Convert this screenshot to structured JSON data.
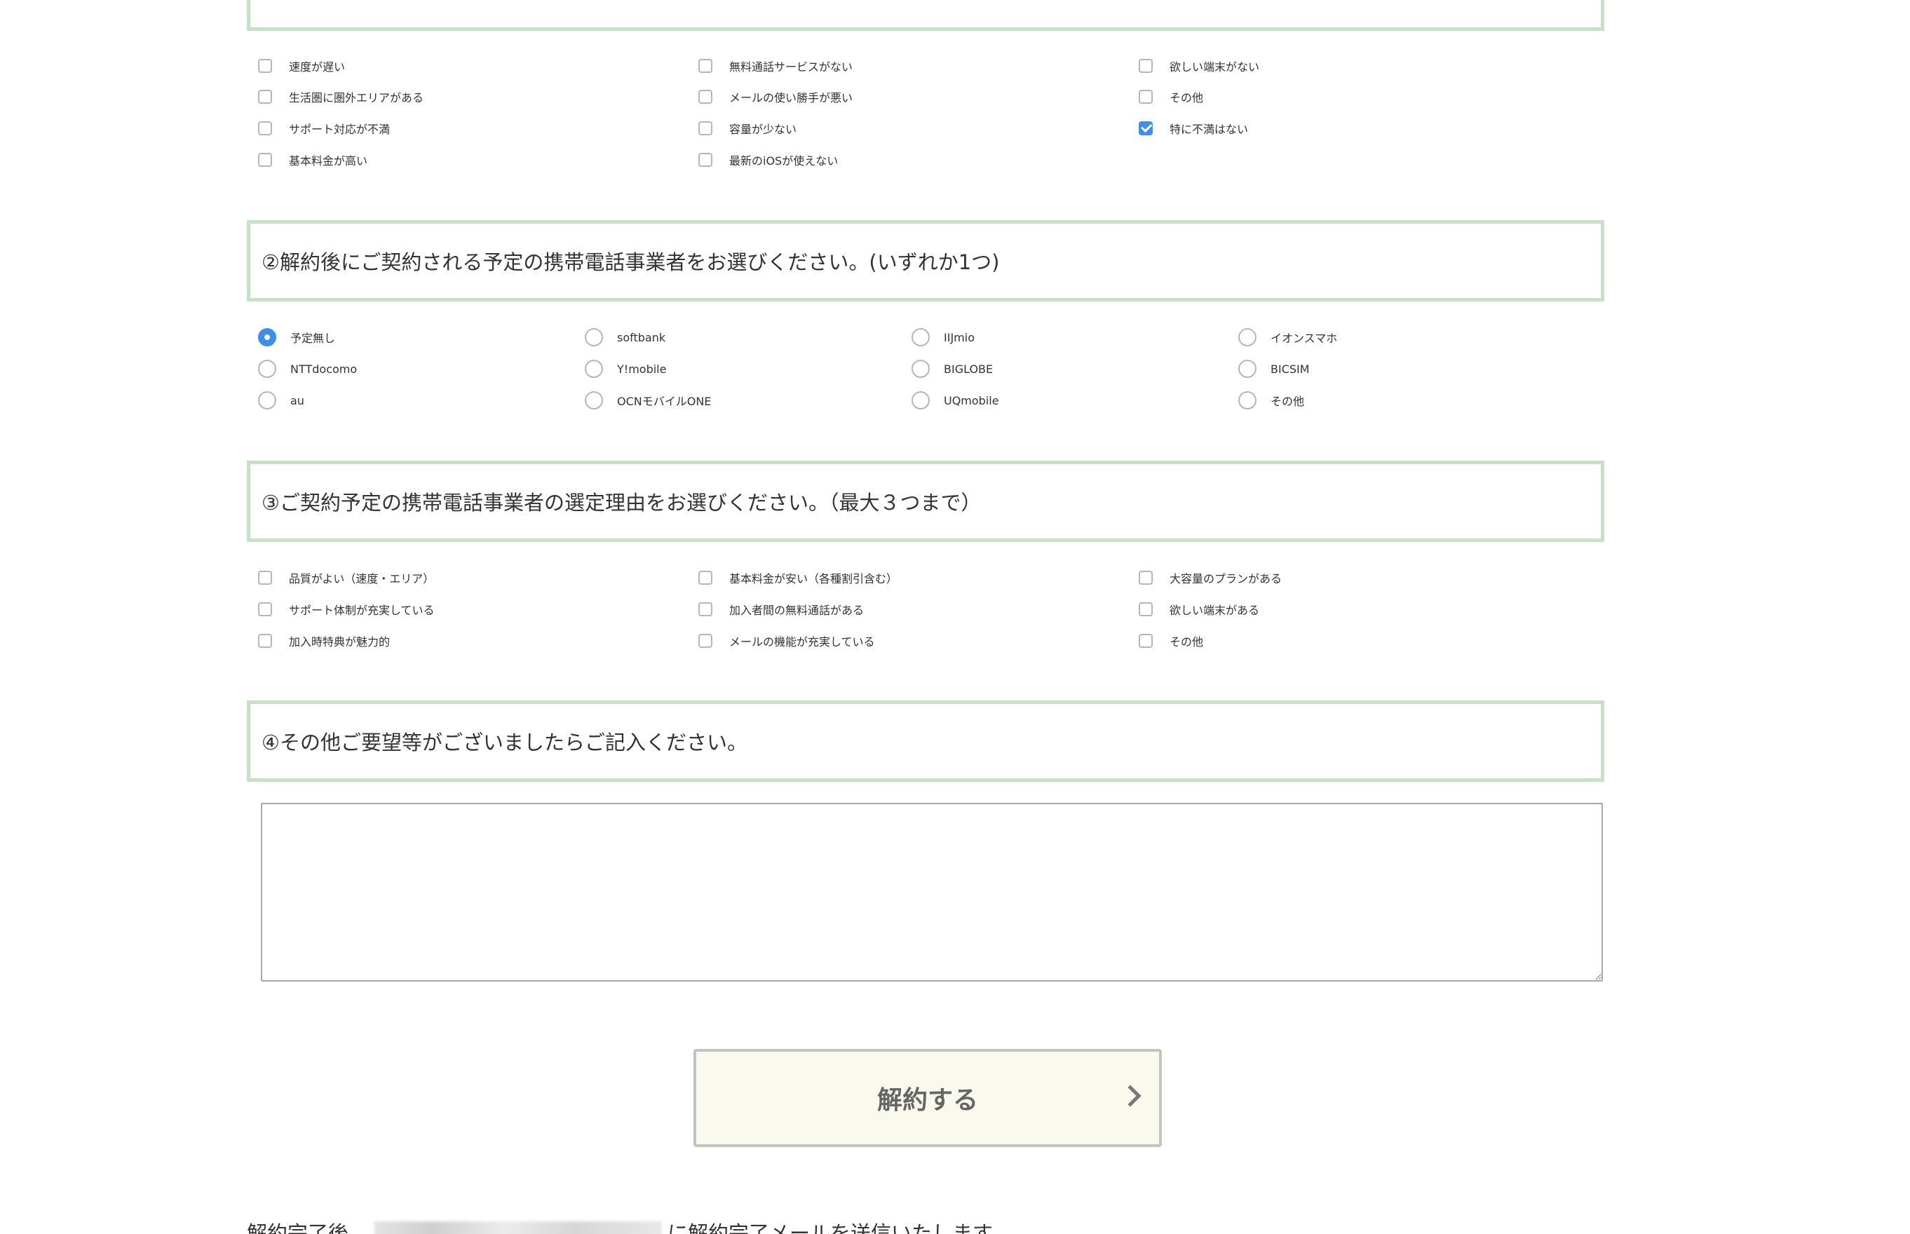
{
  "q1": {
    "options": [
      {
        "label": "速度が遅い",
        "checked": false
      },
      {
        "label": "生活圏に圏外エリアがある",
        "checked": false
      },
      {
        "label": "サポート対応が不満",
        "checked": false
      },
      {
        "label": "基本料金が高い",
        "checked": false
      },
      {
        "label": "無料通話サービスがない",
        "checked": false
      },
      {
        "label": "メールの使い勝手が悪い",
        "checked": false
      },
      {
        "label": "容量が少ない",
        "checked": false
      },
      {
        "label": "最新のiOSが使えない",
        "checked": false
      },
      {
        "label": "欲しい端末がない",
        "checked": false
      },
      {
        "label": "その他",
        "checked": false
      },
      {
        "label": "特に不満はない",
        "checked": true
      }
    ]
  },
  "q2": {
    "title": "②解約後にご契約される予定の携帯電話事業者をお選びください。(いずれか1つ)",
    "options": [
      {
        "label": "予定無し",
        "checked": true
      },
      {
        "label": "NTTdocomo",
        "checked": false
      },
      {
        "label": "au",
        "checked": false
      },
      {
        "label": "softbank",
        "checked": false
      },
      {
        "label": "Y!mobile",
        "checked": false
      },
      {
        "label": "OCNモバイルONE",
        "checked": false
      },
      {
        "label": "IIJmio",
        "checked": false
      },
      {
        "label": "BIGLOBE",
        "checked": false
      },
      {
        "label": "UQmobile",
        "checked": false
      },
      {
        "label": "イオンスマホ",
        "checked": false
      },
      {
        "label": "BICSIM",
        "checked": false
      },
      {
        "label": "その他",
        "checked": false
      }
    ]
  },
  "q3": {
    "title": "③ご契約予定の携帯電話事業者の選定理由をお選びください。（最大３つまで）",
    "options": [
      {
        "label": "品質がよい（速度・エリア）",
        "checked": false
      },
      {
        "label": "サポート体制が充実している",
        "checked": false
      },
      {
        "label": "加入時特典が魅力的",
        "checked": false
      },
      {
        "label": "基本料金が安い（各種割引含む）",
        "checked": false
      },
      {
        "label": "加入者間の無料通話がある",
        "checked": false
      },
      {
        "label": "メールの機能が充実している",
        "checked": false
      },
      {
        "label": "大容量のプランがある",
        "checked": false
      },
      {
        "label": "欲しい端末がある",
        "checked": false
      },
      {
        "label": "その他",
        "checked": false
      }
    ]
  },
  "q4": {
    "title": "④その他ご要望等がございましたらご記入ください。",
    "value": ""
  },
  "submit": {
    "label": "解約する"
  },
  "footer": {
    "prefix": "解約完了後、",
    "suffix": "に解約完了メールを送信いたします。"
  },
  "colors": {
    "section_border": "#c5e2c5",
    "accent": "#3d8fe8",
    "button_bg": "#faf9ed"
  }
}
